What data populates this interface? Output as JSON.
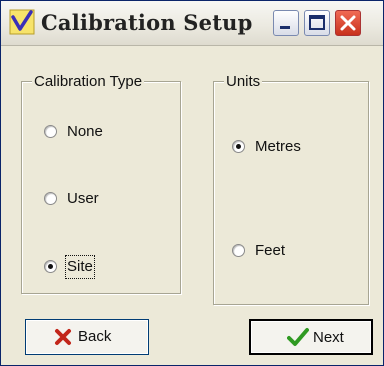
{
  "window": {
    "title": "Calibration Setup"
  },
  "groups": {
    "calibration_type": {
      "legend": "Calibration Type",
      "options": [
        {
          "label": "None",
          "selected": false
        },
        {
          "label": "User",
          "selected": false
        },
        {
          "label": "Site",
          "selected": true
        }
      ]
    },
    "units": {
      "legend": "Units",
      "options": [
        {
          "label": "Metres",
          "selected": true
        },
        {
          "label": "Feet",
          "selected": false
        }
      ]
    }
  },
  "buttons": {
    "back_label": "Back",
    "next_label": "Next"
  },
  "icons": {
    "app": "check-mark-icon",
    "back": "red-x-icon",
    "next": "green-check-icon"
  },
  "colors": {
    "close_button": "#d8412f",
    "back_icon": "#c2261a",
    "next_icon": "#2f9a22",
    "app_icon_check": "#3b2fb8",
    "app_icon_bg": "#f7e36b"
  }
}
